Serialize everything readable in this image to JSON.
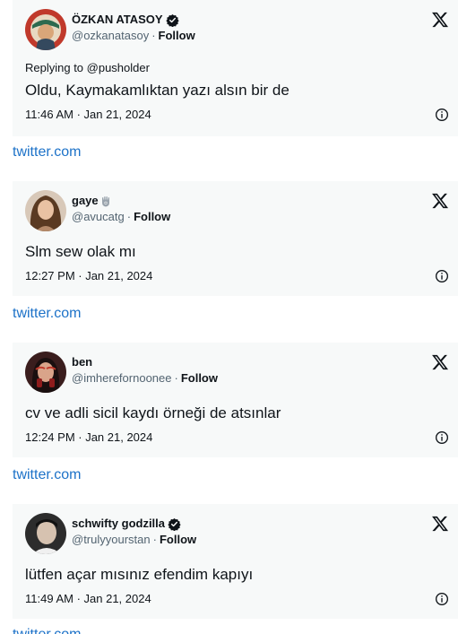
{
  "follow_label": "Follow",
  "link_color": "#1d72c8",
  "tweets": [
    {
      "display_name": "ÖZKAN ATASOY",
      "handle": "@ozkanatasoy",
      "verified": true,
      "replying_to": "Replying to @pusholder",
      "text": "Oldu, Kaymakamlıktan yazı alsın bir de",
      "timestamp": "11:46 AM · Jan 21, 2024",
      "source": "twitter.com"
    },
    {
      "display_name": "gaye",
      "handle": "@avucatg",
      "verified": false,
      "name_icon": "hamsa-emoji",
      "text": "Slm sew olak mı",
      "timestamp": "12:27 PM · Jan 21, 2024",
      "source": "twitter.com"
    },
    {
      "display_name": "ben",
      "handle": "@imherefornoonee",
      "verified": false,
      "text": "cv ve adli sicil kaydı örneği de atsınlar",
      "timestamp": "12:24 PM · Jan 21, 2024",
      "source": "twitter.com"
    },
    {
      "display_name": "schwifty godzilla",
      "handle": "@trulyyourstan",
      "verified": true,
      "text": "lütfen açar mısınız efendim kapıyı",
      "timestamp": "11:49 AM · Jan 21, 2024",
      "source": "twitter.com"
    }
  ],
  "icons": {
    "brand": "x-logo-icon",
    "info": "info-icon",
    "verified": "verified-badge-icon"
  }
}
